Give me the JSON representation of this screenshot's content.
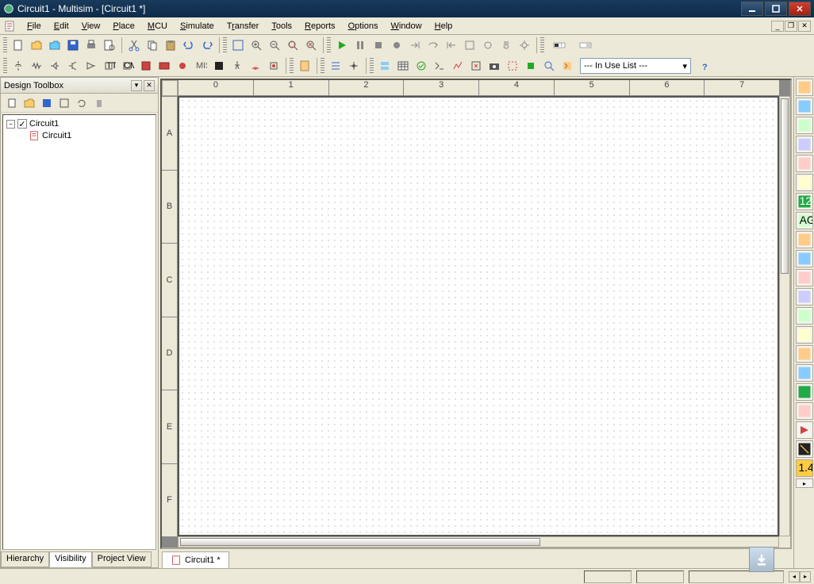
{
  "titlebar": {
    "title": "Circuit1 - Multisim - [Circuit1 *]"
  },
  "menu": {
    "items": [
      "File",
      "Edit",
      "View",
      "Place",
      "MCU",
      "Simulate",
      "Transfer",
      "Tools",
      "Reports",
      "Options",
      "Window",
      "Help"
    ]
  },
  "toolbox": {
    "title": "Design Toolbox",
    "tree": {
      "root": "Circuit1",
      "child": "Circuit1"
    },
    "tabs": [
      "Hierarchy",
      "Visibility",
      "Project View"
    ],
    "active_tab": "Visibility"
  },
  "ruler": {
    "h": [
      "0",
      "1",
      "2",
      "3",
      "4",
      "5",
      "6",
      "7"
    ],
    "v": [
      "A",
      "B",
      "C",
      "D",
      "E",
      "F"
    ]
  },
  "doc_tab": "Circuit1 *",
  "in_use_list": "--- In Use List ---",
  "instruments_count": 20
}
